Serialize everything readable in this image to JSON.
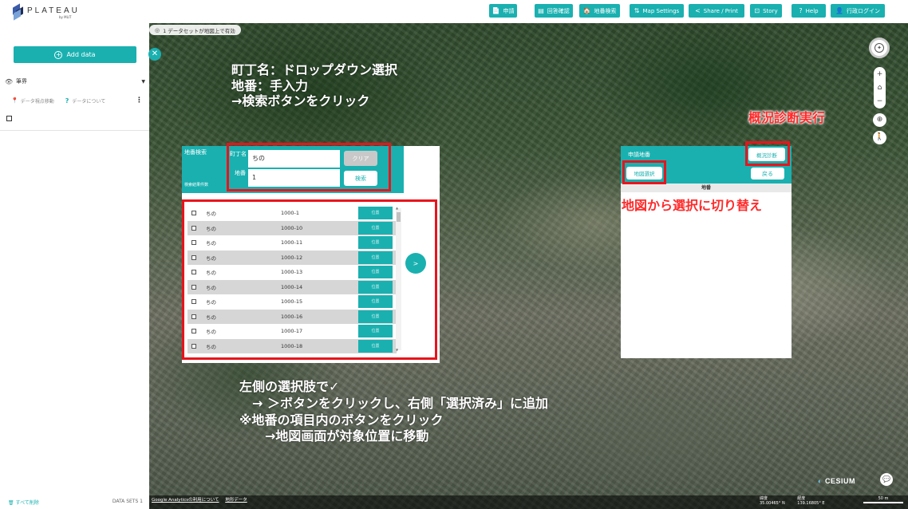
{
  "app": {
    "logo_text": "PLATEAU",
    "logo_sub": "by MLIT"
  },
  "topbar": {
    "buttons": [
      {
        "icon": "📄",
        "label": "申請"
      },
      {
        "icon": "▤",
        "label": "回答確認"
      },
      {
        "icon": "🏠",
        "label": "地番検索"
      },
      {
        "icon": "⇅",
        "label": "Map Settings"
      },
      {
        "icon": "<",
        "label": "Share / Print"
      },
      {
        "icon": "⊡",
        "label": "Story"
      },
      {
        "icon": "?",
        "label": "Help"
      },
      {
        "icon": "👤",
        "label": "行政ログイン"
      }
    ]
  },
  "sidebar": {
    "add_data_label": "Add data",
    "layer_name": "筆界",
    "action_locate": "データ視点移動",
    "action_about": "データについて",
    "remove_all": "すべて削除",
    "dataset_count": "DATA SETS 1"
  },
  "map": {
    "dataset_pill": "1 データセットが地図上で有効",
    "credits": [
      "Google Analyticsの利用について",
      "地形データ"
    ],
    "coords": {
      "lat_label": "緯度",
      "lat": "35.00465° N",
      "lon_label": "経度",
      "lon": "139.16805° E"
    },
    "scale_label": "50 m",
    "cesium_label": "CESIUM"
  },
  "search_dialog": {
    "title": "地番検索",
    "results_label": "検索結果件数",
    "town_label": "町丁名",
    "town_value": "ちの",
    "chiban_label": "地番",
    "chiban_value": "1",
    "clear_label": "クリア",
    "search_label": "検索",
    "move_right_label": ">",
    "rows": [
      {
        "town": "ちの",
        "number": "1000-1",
        "loc": "位置"
      },
      {
        "town": "ちの",
        "number": "1000-10",
        "loc": "位置"
      },
      {
        "town": "ちの",
        "number": "1000-11",
        "loc": "位置"
      },
      {
        "town": "ちの",
        "number": "1000-12",
        "loc": "位置"
      },
      {
        "town": "ちの",
        "number": "1000-13",
        "loc": "位置"
      },
      {
        "town": "ちの",
        "number": "1000-14",
        "loc": "位置"
      },
      {
        "town": "ちの",
        "number": "1000-15",
        "loc": "位置"
      },
      {
        "town": "ちの",
        "number": "1000-16",
        "loc": "位置"
      },
      {
        "town": "ちの",
        "number": "1000-17",
        "loc": "位置"
      },
      {
        "town": "ちの",
        "number": "1000-18",
        "loc": "位置"
      }
    ]
  },
  "selected_panel": {
    "title": "申請地番",
    "map_select_label": "地図選択",
    "diagnose_label": "概況診断",
    "back_label": "戻る",
    "column_header": "地番"
  },
  "annotations": {
    "top_left": [
      "町丁名：ドロップダウン選択",
      "地番：手入力",
      "→検索ボタンをクリック"
    ],
    "top_right": "概況診断実行",
    "middle_right": "地図から選択に切り替え",
    "bottom": [
      "左側の選択肢で✓",
      "　→ ＞ボタンをクリックし、右側「選択済み」に追加",
      "※地番の項目内のボタンをクリック",
      "　　→地図画面が対象位置に移動"
    ]
  }
}
